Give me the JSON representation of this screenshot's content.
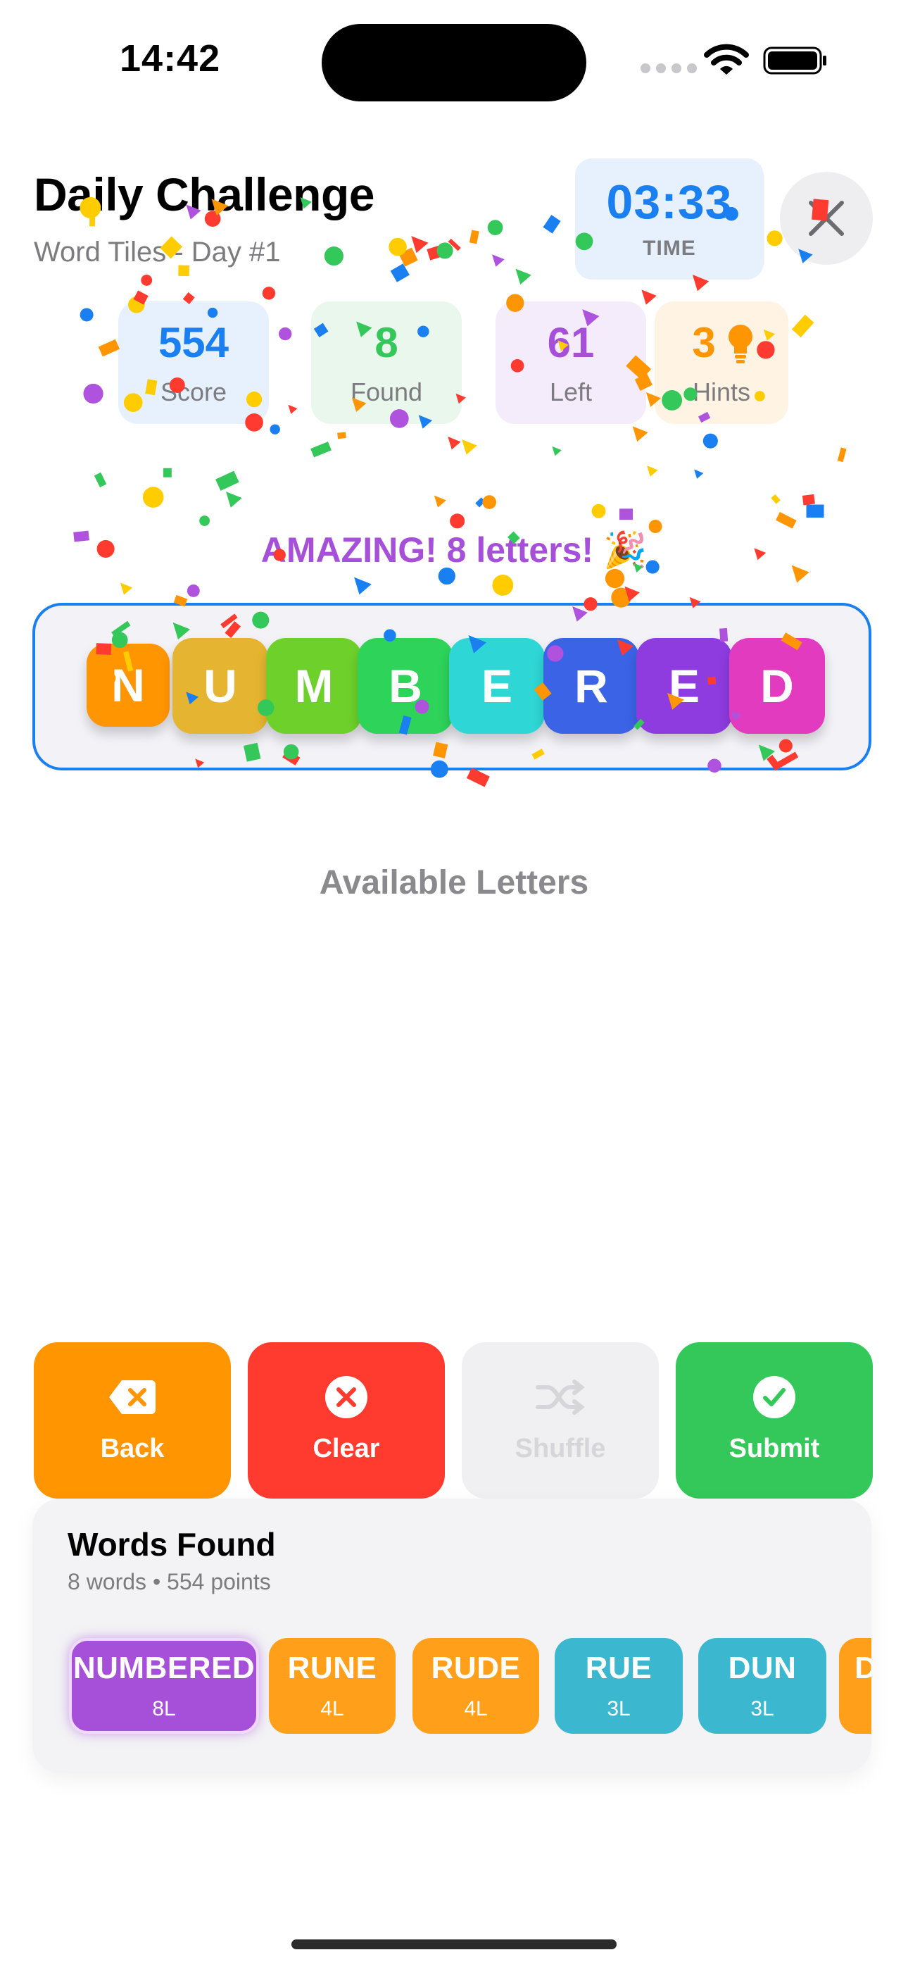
{
  "status_bar": {
    "time": "14:42"
  },
  "header": {
    "title": "Daily Challenge",
    "subtitle": "Word Tiles - Day #1",
    "timer_value": "03:33",
    "timer_label": "TIME"
  },
  "stats": [
    {
      "value": "554",
      "label": "Score",
      "color": "#1a7ff0",
      "bg": "#e7f1fd"
    },
    {
      "value": "8",
      "label": "Found",
      "color": "#34c759",
      "bg": "#e9f7ec"
    },
    {
      "value": "61",
      "label": "Left",
      "color": "#a64fd9",
      "bg": "#f4ebfb"
    },
    {
      "value": "3",
      "label": "Hints",
      "color": "#ff9500",
      "bg": "#fff3e4"
    }
  ],
  "message": "AMAZING! 8 letters! 🎉",
  "current_word": [
    {
      "letter": "N",
      "color": "#ff9500"
    },
    {
      "letter": "U",
      "color": "#e5b531"
    },
    {
      "letter": "M",
      "color": "#6ed12b"
    },
    {
      "letter": "B",
      "color": "#2ed35a"
    },
    {
      "letter": "E",
      "color": "#2fd6d6"
    },
    {
      "letter": "R",
      "color": "#3b63e6"
    },
    {
      "letter": "E",
      "color": "#8e3be0"
    },
    {
      "letter": "D",
      "color": "#e33bbf"
    }
  ],
  "available_letters_label": "Available Letters",
  "actions": {
    "back": {
      "label": "Back",
      "color": "#ff9500",
      "icon": "backspace-icon"
    },
    "clear": {
      "label": "Clear",
      "color": "#ff3b30",
      "icon": "x-circle-icon"
    },
    "shuffle": {
      "label": "Shuffle",
      "color": "#f0f0f2",
      "icon": "shuffle-icon"
    },
    "submit": {
      "label": "Submit",
      "color": "#34c759",
      "icon": "checkmark-circle-icon"
    }
  },
  "words_found": {
    "title": "Words Found",
    "summary": "8 words • 554 points",
    "words": [
      {
        "word": "NUMBERED",
        "length": "8L",
        "color": "#a64fd9"
      },
      {
        "word": "RUNE",
        "length": "4L",
        "color": "#ff9f1a"
      },
      {
        "word": "RUDE",
        "length": "4L",
        "color": "#ff9f1a"
      },
      {
        "word": "RUE",
        "length": "3L",
        "color": "#3bb8cf"
      },
      {
        "word": "DUN",
        "length": "3L",
        "color": "#3bb8cf"
      },
      {
        "word": "D",
        "length": "",
        "color": "#ff9f1a"
      }
    ]
  }
}
